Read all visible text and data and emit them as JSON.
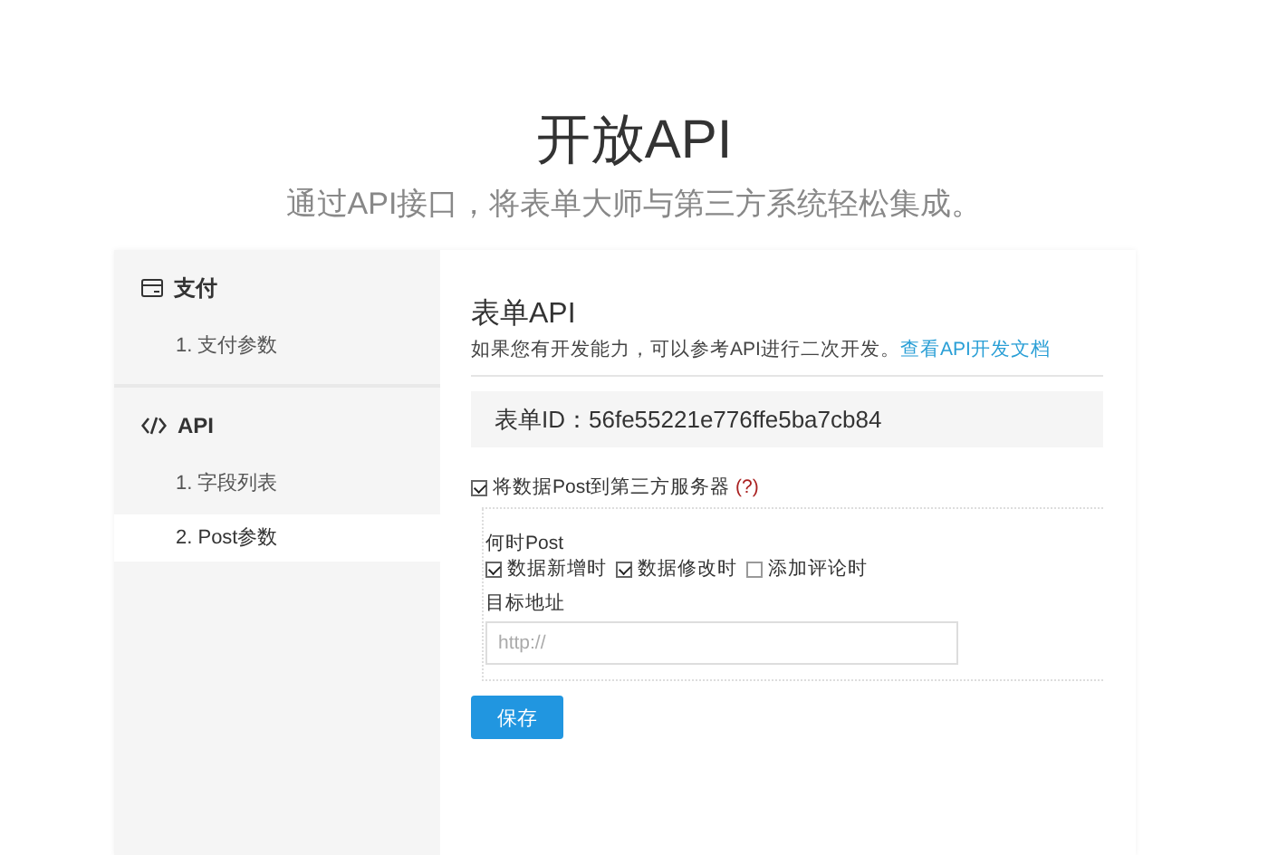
{
  "header": {
    "title": "开放API",
    "subtitle": "通过API接口，将表单大师与第三方系统轻松集成。"
  },
  "sidebar": {
    "groups": [
      {
        "title": "支付",
        "kind": "payment",
        "items": [
          {
            "label": "1. 支付参数",
            "selected": false
          }
        ]
      },
      {
        "title": "API",
        "kind": "api",
        "items": [
          {
            "label": "1. 字段列表",
            "selected": false
          },
          {
            "label": "2. Post参数",
            "selected": true
          }
        ]
      }
    ]
  },
  "main": {
    "title": "表单API",
    "description": "如果您有开发能力，可以参考API进行二次开发。",
    "doc_link": "查看API开发文档",
    "form_id": "表单ID：56fe55221e776ffe5ba7cb84",
    "post_option": {
      "label": "将数据Post到第三方服务器",
      "checked": true,
      "help": "(?)"
    },
    "when_label": "何时Post",
    "when_options": [
      {
        "label": "数据新增时",
        "checked": true
      },
      {
        "label": "数据修改时",
        "checked": true
      },
      {
        "label": "添加评论时",
        "checked": false
      }
    ],
    "url_label": "目标地址",
    "url_placeholder": "http://",
    "save_button": "保存"
  }
}
